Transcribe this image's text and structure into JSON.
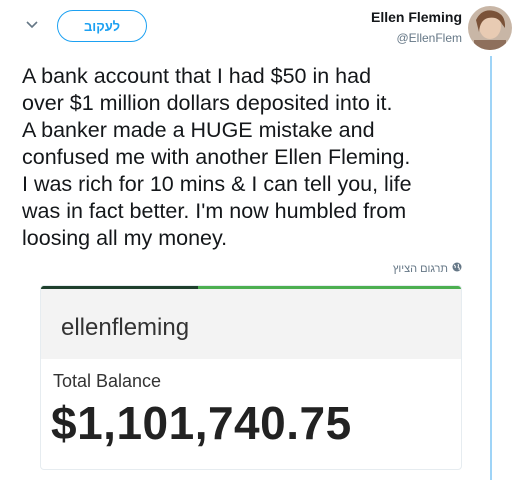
{
  "header": {
    "follow_label": "לעקוב",
    "display_name": "Ellen Fleming",
    "handle": "@EllenFlem"
  },
  "tweet": {
    "lines": [
      "A bank account that I had $50 in had",
      "over $1 million dollars deposited into it.",
      "A banker made a HUGE mistake and",
      "confused me with another Ellen Fleming.",
      "I was rich for 10 mins & I can tell you, life",
      "was in fact better. I'm now humbled from",
      "loosing all my money."
    ],
    "translate_label": "תרגום הציוץ"
  },
  "card": {
    "username": "ellenfleming",
    "balance_label": "Total Balance",
    "balance_amount": "$1,101,740.75"
  },
  "colors": {
    "accent": "#1da1f2",
    "thread_line": "#9fd4f7",
    "card_bar": "#4caf50"
  },
  "icons": {
    "chevron": "chevron-down-icon",
    "globe": "globe-icon"
  }
}
